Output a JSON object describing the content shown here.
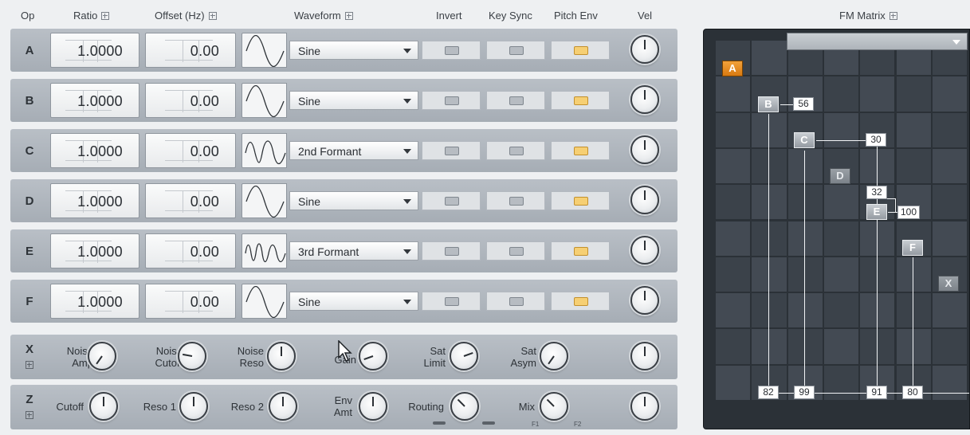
{
  "header": {
    "op": "Op",
    "ratio": "Ratio",
    "offset": "Offset (Hz)",
    "waveform": "Waveform",
    "invert": "Invert",
    "key_sync": "Key Sync",
    "pitch_env": "Pitch Env",
    "vel": "Vel",
    "fm_matrix": "FM Matrix"
  },
  "operators": [
    {
      "letter": "A",
      "ratio": "1.0000",
      "offset": "0.00",
      "waveform": "Sine",
      "invert": false,
      "key_sync": false,
      "pitch_env": true
    },
    {
      "letter": "B",
      "ratio": "1.0000",
      "offset": "0.00",
      "waveform": "Sine",
      "invert": false,
      "key_sync": false,
      "pitch_env": true
    },
    {
      "letter": "C",
      "ratio": "1.0000",
      "offset": "0.00",
      "waveform": "2nd Formant",
      "invert": false,
      "key_sync": false,
      "pitch_env": true
    },
    {
      "letter": "D",
      "ratio": "1.0000",
      "offset": "0.00",
      "waveform": "Sine",
      "invert": false,
      "key_sync": false,
      "pitch_env": true
    },
    {
      "letter": "E",
      "ratio": "1.0000",
      "offset": "0.00",
      "waveform": "3rd Formant",
      "invert": false,
      "key_sync": false,
      "pitch_env": true
    },
    {
      "letter": "F",
      "ratio": "1.0000",
      "offset": "0.00",
      "waveform": "Sine",
      "invert": false,
      "key_sync": false,
      "pitch_env": true
    }
  ],
  "x_row": {
    "letter": "X",
    "noise_amp": "Noise\nAmp",
    "noise_cutoff": "Noise\nCutoff",
    "noise_reso": "Noise\nReso",
    "gain": "Gain",
    "sat_limit": "Sat\nLimit",
    "sat_asym": "Sat\nAsym"
  },
  "z_row": {
    "letter": "Z",
    "cutoff": "Cutoff",
    "reso1": "Reso 1",
    "reso2": "Reso 2",
    "env_amt": "Env\nAmt",
    "routing": "Routing",
    "mix": "Mix",
    "f1": "F1",
    "f2": "F2"
  },
  "matrix": {
    "nodes": [
      "A",
      "B",
      "C",
      "D",
      "E",
      "F",
      "X"
    ],
    "amounts": {
      "b_in": "56",
      "c_in": "30",
      "e_top": "32",
      "e_in": "100",
      "out_b": "82",
      "out_c": "99",
      "out_e": "91",
      "out_f": "80"
    }
  },
  "colors": {
    "accent": "#e6901e",
    "pitch_on": "#f6cf73",
    "matrix_bg": "#2b3137"
  }
}
